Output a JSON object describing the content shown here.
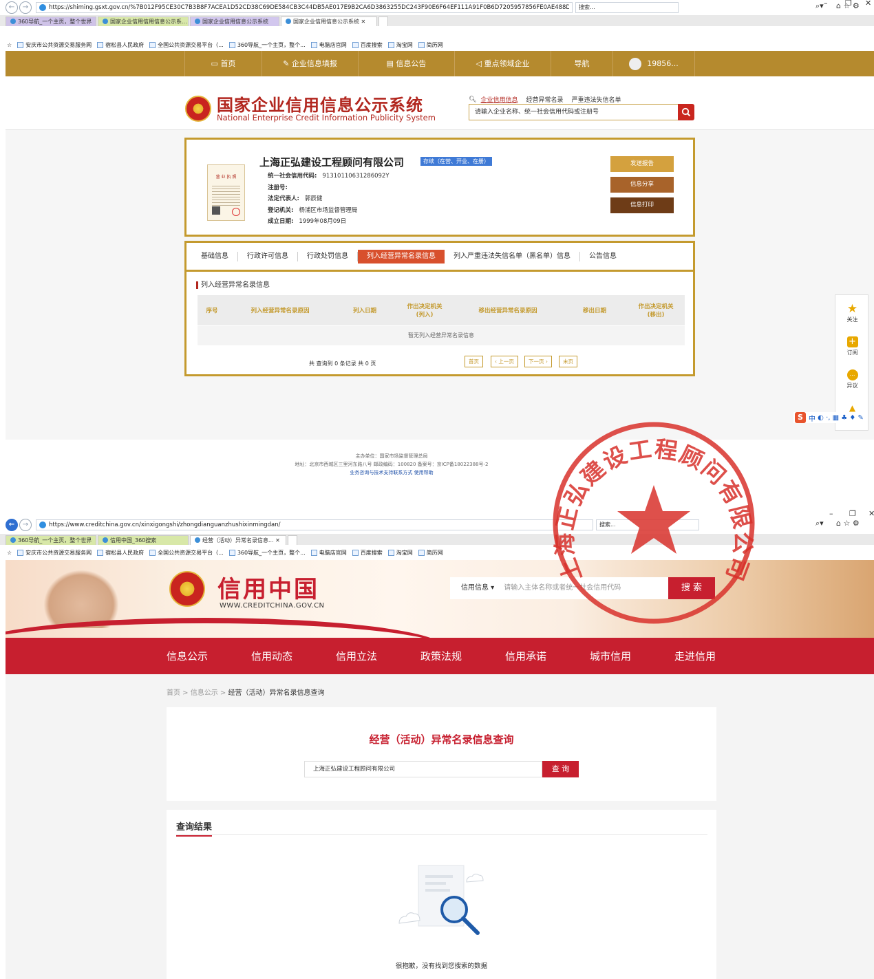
{
  "browser1": {
    "url": "https://shiming.gsxt.gov.cn/%7B012F95CE30C7B3B8F7ACEA1D52CD38C69DE584CB3C44DB5AE017E9B2CA6D3863255DC243F90E6F64EF111A91F0B6D7205957856FE0AE488DC311DC1957076B8B87198719",
    "search": "搜索...",
    "tabs": [
      "360导航_一个主页，整个世界",
      "国家企业信用信用信息公示系...",
      "国家企业信用信息公示系统",
      "国家企业信用信息公示系统"
    ],
    "favs": [
      "安庆市公共资源交易服务网",
      "宿松县人民政府",
      "全国公共资源交易平台（...",
      "360导航_一个主页，整个...",
      "电脑店官网",
      "百度搜索",
      "淘宝网",
      "简历网"
    ]
  },
  "gsxt": {
    "nav": [
      "首页",
      "企业信息填报",
      "信息公告",
      "重点领域企业",
      "导航",
      "19856..."
    ],
    "title": "国家企业信用信息公示系统",
    "subtitle": "National Enterprise Credit Information Publicity System",
    "search_tabs": [
      "企业信用信息",
      "经营异常名录",
      "严重违法失信名单"
    ],
    "search_placeholder": "请输入企业名称、统一社会信用代码或注册号",
    "license_caption": "营 业 执 照",
    "company": "上海正弘建设工程顾问有限公司",
    "status": "存续（在营、开业、在册）",
    "fields": [
      {
        "k": "统一社会信用代码:",
        "v": "91310110631286092Y"
      },
      {
        "k": "注册号:",
        "v": ""
      },
      {
        "k": "法定代表人:",
        "v": "郭辰健"
      },
      {
        "k": "登记机关:",
        "v": "杨浦区市场监督管理局"
      },
      {
        "k": "成立日期:",
        "v": "1999年08月09日"
      }
    ],
    "buttons": [
      "发送报告",
      "信息分享",
      "信息打印"
    ],
    "tabs": [
      "基础信息",
      "行政许可信息",
      "行政处罚信息",
      "列入经营异常名录信息",
      "列入严重违法失信名单（黑名单）信息",
      "公告信息"
    ],
    "section": "列入经营异常名录信息",
    "columns": [
      "序号",
      "列入经营异常名录原因",
      "列入日期",
      "作出决定机关\n(列入)",
      "移出经营异常名录原因",
      "移出日期",
      "作出决定机关\n(移出)"
    ],
    "empty": "暂无列入经营异常名录信息",
    "pager_info": "共 查询到 0 条记录 共 0 页",
    "pager": [
      "首页",
      "‹ 上一页",
      "下一页 ›",
      "末页"
    ],
    "side": [
      "关注",
      "订阅",
      "异议",
      "返回"
    ],
    "footer": [
      "主办单位：国家市场监督管理总局",
      "地址：北京市西城区三里河东路八号  邮政编码：100820  备案号：京ICP备18022388号-2",
      "业务咨询与技术支持联系方式    使用帮助"
    ],
    "ime": "中"
  },
  "browser2": {
    "url": "https://www.creditchina.gov.cn/xinxigongshi/zhongdianguanzhushixinmingdan/",
    "search": "搜索...",
    "tabs": [
      "360导航_一个主页，整个世界",
      "信用中国_360搜索",
      "经营（活动）异常名录信息..."
    ],
    "favs": [
      "安庆市公共资源交易服务网",
      "宿松县人民政府",
      "全国公共资源交易平台（...",
      "360导航_一个主页，整个...",
      "电脑店官网",
      "百度搜索",
      "淘宝网",
      "简历网"
    ]
  },
  "creditchina": {
    "title": "信用中国",
    "url": "WWW.CREDITCHINA.GOV.CN",
    "search_category": "信用信息",
    "search_placeholder": "请输入主体名称或者统一社会信用代码",
    "search_button": "搜 索",
    "nav": [
      "信息公示",
      "信用动态",
      "信用立法",
      "政策法规",
      "信用承诺",
      "城市信用",
      "走进信用"
    ],
    "crumb_home": "首页",
    "crumb_mid": "信息公示",
    "crumb_cur": "经营（活动）异常名录信息查询",
    "query_title": "经营（活动）异常名录信息查询",
    "query_value": "上海正弘建设工程顾问有限公司",
    "query_button": "查 询",
    "result_title": "查询结果",
    "empty_msg": "很抱歉，没有找到您搜索的数据"
  },
  "seal": {
    "text": "上海正弘建设工程顾问有限公司",
    "color": "#d8312b"
  }
}
